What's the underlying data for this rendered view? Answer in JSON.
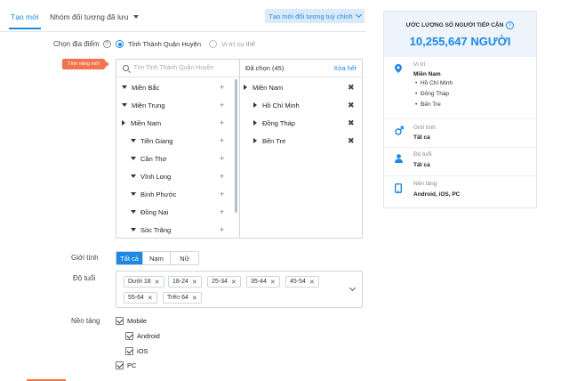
{
  "tabs": {
    "new": "Tạo mới",
    "saved_groups": "Nhóm đối tượng đã lưu",
    "create_custom": "Tạo mới đối tượng tuỳ chỉnh"
  },
  "location": {
    "label": "Chọn địa điểm",
    "option_province": "Tỉnh Thành Quận Huyện",
    "option_exact": "Vị trí cụ thể",
    "new_feature_badge": "Tính năng mới",
    "search_placeholder": "Tìm Tỉnh Thành Quận Huyện",
    "tree": [
      {
        "label": "Miền Bắc",
        "expanded": true
      },
      {
        "label": "Miền Trung",
        "expanded": true
      },
      {
        "label": "Miền Nam",
        "expanded": false
      },
      {
        "label": "Tiền Giang",
        "expanded": true
      },
      {
        "label": "Cần Thơ",
        "expanded": true
      },
      {
        "label": "Vĩnh Long",
        "expanded": true
      },
      {
        "label": "Bình Phước",
        "expanded": true
      },
      {
        "label": "Đồng Nai",
        "expanded": true
      },
      {
        "label": "Sóc Trăng",
        "expanded": true
      }
    ],
    "selected_header": "Đã chọn (45)",
    "clear_all": "Xóa hết",
    "selected": [
      {
        "label": "Miền Nam"
      },
      {
        "label": "Hồ Chí Minh"
      },
      {
        "label": "Đồng Tháp"
      },
      {
        "label": "Bến Tre"
      }
    ]
  },
  "gender": {
    "label": "Giới tính",
    "options": [
      "Tất cả",
      "Nam",
      "Nữ"
    ],
    "selected": "Tất cả"
  },
  "age": {
    "label": "Độ tuổi",
    "chips": [
      "Dưới 18",
      "18-24",
      "25-34",
      "35-44",
      "45-54",
      "55-64",
      "Trên 64"
    ]
  },
  "platform": {
    "label": "Nền tảng",
    "mobile": "Mobile",
    "android": "Android",
    "ios": "iOS",
    "pc": "PC"
  },
  "summary": {
    "reach_title": "ƯỚC LƯỢNG SỐ NGƯỜI TIẾP CẬN",
    "reach_value": "10,255,647 NGƯỜI",
    "location_label": "Vị trí",
    "location_value": "Miền Nam",
    "location_items": [
      "Hồ Chí Minh",
      "Đồng Tháp",
      "Bến Tre"
    ],
    "gender_label": "Giới tính",
    "gender_value": "Tất cả",
    "age_label": "Độ tuổi",
    "age_value": "Tất cả",
    "platform_label": "Nền tảng",
    "platform_value": "Android, iOS, PC"
  },
  "colors": {
    "accent": "#1e88e5",
    "badge": "#f4734f",
    "summary_bg": "#edf4fc"
  }
}
